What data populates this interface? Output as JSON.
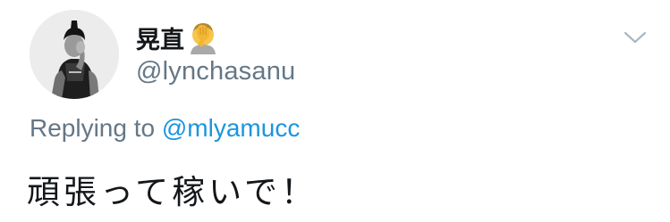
{
  "tweet": {
    "display_name": "晃直",
    "display_name_emoji": "face-palm-emoji",
    "username": "@lynchasanu",
    "replying_prefix": "Replying to",
    "replying_to": "@mlyamucc",
    "text": "頑張って稼いで！",
    "menu_icon": "chevron-down-icon"
  },
  "colors": {
    "text_primary": "#14171a",
    "text_secondary": "#657786",
    "link": "#1b95e0",
    "caret": "#aab8c2",
    "background": "#ffffff"
  }
}
